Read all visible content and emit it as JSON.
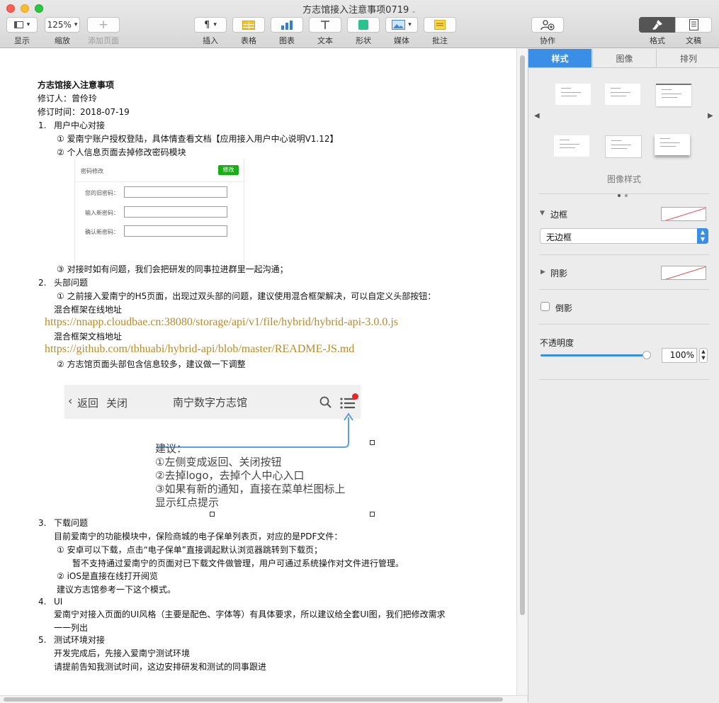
{
  "window": {
    "title": "方志馆接入注意事项0719"
  },
  "toolbar": {
    "view_label": "显示",
    "zoom_value": "125%",
    "zoom_label": "缩放",
    "add_page_label": "添加页面",
    "insert_label": "插入",
    "table_label": "表格",
    "chart_label": "图表",
    "text_label": "文本",
    "shape_label": "形状",
    "media_label": "媒体",
    "comment_label": "批注",
    "collaborate_label": "协作",
    "format_label": "格式",
    "document_label": "文稿"
  },
  "doc": {
    "title": "方志馆接入注意事项",
    "reviser": "修订人：曾伶玲",
    "revised_time": "修订时间：2018-07-19",
    "s1_num": "1.",
    "s1_title": "用户中心对接",
    "s1_i1": "①  爱南宁账户授权登陆，具体情查看文档【应用接入用户中心说明V1.12】",
    "s1_i2": "②  个人信息页面去掉修改密码模块",
    "s1_i3": "③  对接时如有问题，我们会把研发的同事拉进群里一起沟通；",
    "s2_num": "2.",
    "s2_title": "头部问题",
    "s2_i1": "①  之前接入爱南宁的H5页面，出现过双头部的问题，建议使用混合框架解决，可以自定义头部按钮：",
    "s2_hybrid_online": "混合框架在线地址",
    "s2_link1": "https://nnapp.cloudbae.cn:38080/storage/api/v1/file/hybrid/hybrid-api-3.0.0.js",
    "s2_hybrid_doc": "混合框架文档地址",
    "s2_link2": "https://github.com/tbhuabi/hybrid-api/blob/master/README-JS.md",
    "s2_i2": "②  方志馆页面头部包含信息较多，建议做一下调整",
    "s3_num": "3.",
    "s3_title": "下载问题",
    "s3_p1": "目前爱南宁的功能模块中，保险商城的电子保单列表页，对应的是PDF文件：",
    "s3_i1": "①  安卓可以下载，点击“电子保单”直接调起默认浏览器跳转到下载页；",
    "s3_i1b": "暂不支持通过爱南宁的页面对已下载文件做管理，用户可通过系统操作对文件进行管理。",
    "s3_i2": "②  iOS是直接在线打开阅览",
    "s3_p2": "建议方志馆参考一下这个模式。",
    "s4_num": "4.",
    "s4_title": "UI",
    "s4_p1": "爱南宁对接入页面的UI风格（主要是配色、字体等）有具体要求，所以建议给全套UI图，我们把修改需求",
    "s4_p2": "一一列出",
    "s5_num": "5.",
    "s5_title": "测试环境对接",
    "s5_p1": "开发完成后，先接入爱南宁测试环境",
    "s5_p2": "请提前告知我测试时间，这边安排研发和测试的同事跟进"
  },
  "shot1": {
    "title": "密码修改",
    "button": "修改",
    "old_pw": "您的旧密码：",
    "new_pw": "输入新密码：",
    "confirm_pw": "确认新密码："
  },
  "shot2": {
    "back": "返回",
    "close": "关闭",
    "title": "南宁数字方志馆",
    "note_title": "建议：",
    "note_1": "①左侧变成返回、关闭按钮",
    "note_2": "②去掉logo，去掉个人中心入口",
    "note_3": "③如果有新的通知，直接在菜单栏图标上",
    "note_4": "显示红点提示"
  },
  "inspector": {
    "tab_style": "样式",
    "tab_image": "图像",
    "tab_arrange": "排列",
    "image_styles_label": "图像样式",
    "border_label": "边框",
    "border_value": "无边框",
    "shadow_label": "阴影",
    "reflection_label": "倒影",
    "opacity_label": "不透明度",
    "opacity_value": "100%",
    "opacity_level": 1.0
  },
  "colors": {
    "accent": "#3a8ee6",
    "link": "#b88a2a",
    "green": "#1aad19",
    "red": "#e8242a"
  }
}
